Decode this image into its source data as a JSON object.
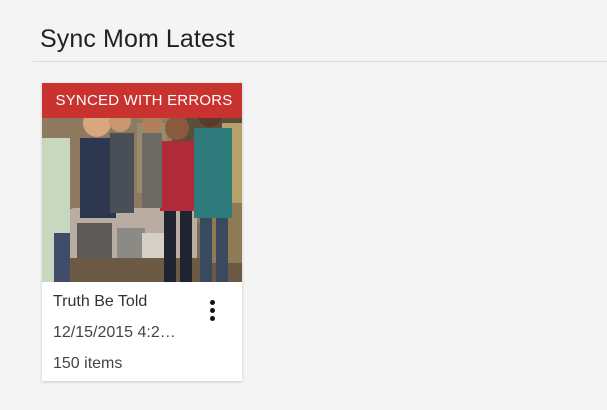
{
  "section": {
    "title": "Sync Mom Latest"
  },
  "card": {
    "status_badge": "SYNCED WITH ERRORS",
    "status_color": "#c8322f",
    "thumbnail_icon": "tv-scene-image",
    "title": "Truth Be Told",
    "date": "12/15/2015 4:2…",
    "item_count": "150 items",
    "menu_icon": "more-vert-icon"
  }
}
